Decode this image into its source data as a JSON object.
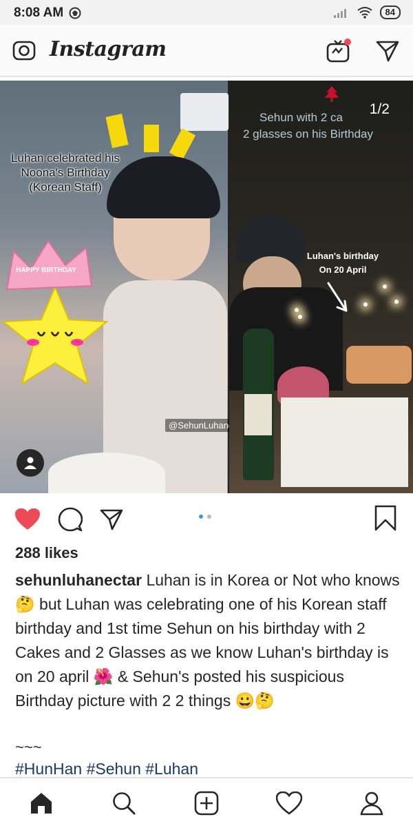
{
  "status_bar": {
    "time": "8:08 AM",
    "battery": "84"
  },
  "header": {
    "app_title": "Instagram"
  },
  "post": {
    "image": {
      "left_caption_lines": [
        "Luhan celebrated his",
        "Noona's Birthday",
        "(Korean Staff)"
      ],
      "right_caption_lines": [
        "Sehun with 2 ca",
        "2 glasses on his Birthday"
      ],
      "counter": "1/2",
      "note_lines": [
        "Luhan's birthday",
        "On 20 April"
      ],
      "watermark": "@SehunLuhanectar",
      "crown_text": "HAPPY BIRTHDAY"
    },
    "likes": "288 likes",
    "username": "sehunluhanectar",
    "caption_text": "Luhan is in Korea or Not who knows🤔 but Luhan was celebrating one of his Korean staff birthday and 1st time Sehun on his birthday with 2 Cakes and 2 Glasses as we know Luhan's birthday is on 20 april 🌺 & Sehun's posted his suspicious Birthday picture with 2 2 things 😀🤔",
    "tilde": "~~~",
    "hashtags": "#HunHan #Sehun #Luhan",
    "liked": true
  },
  "colors": {
    "like_red": "#ed4956",
    "carousel_active": "#3897f0",
    "hashtag": "#1a3a6b"
  },
  "icons": [
    "camera-icon",
    "igtv-icon",
    "direct-icon",
    "heart-icon",
    "comment-icon",
    "share-icon",
    "bookmark-icon",
    "home-icon",
    "search-icon",
    "add-icon",
    "activity-icon",
    "profile-icon"
  ]
}
